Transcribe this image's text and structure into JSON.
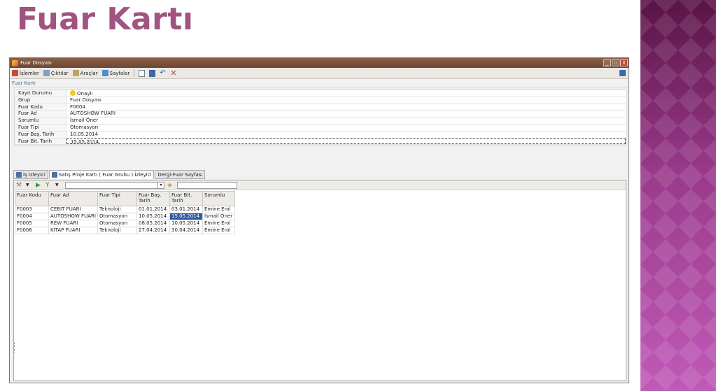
{
  "slide": {
    "title": "Fuar Kartı",
    "title_color": "#a0547f",
    "band_color": "#8a2c7c"
  },
  "window": {
    "title": "Fuar Dosyası",
    "controls": [
      "_",
      "▫",
      "X"
    ],
    "titlebar_color": "#6b4633"
  },
  "menubar": {
    "items": [
      {
        "label": "İşlemler",
        "icon": "operations-icon"
      },
      {
        "label": "Çıktılar",
        "icon": "outputs-icon"
      },
      {
        "label": "Araçlar",
        "icon": "tools-icon"
      },
      {
        "label": "Sayfalar",
        "icon": "pages-icon"
      }
    ],
    "tool_icons": [
      "new-document-icon",
      "save-icon",
      "undo-icon",
      "delete-icon"
    ]
  },
  "form": {
    "caption": "Fuar Kartı",
    "rows": [
      {
        "label": "Kayıt Durumu",
        "value": "Onaylı"
      },
      {
        "label": "Grup",
        "value": "Fuar Dosyası"
      },
      {
        "label": "Fuar Kodu",
        "value": "F0004"
      },
      {
        "label": "Fuar Ad",
        "value": "AUTOSHOW FUARI"
      },
      {
        "label": "Sorumlu",
        "value": "İsmail Öner"
      },
      {
        "label": "Fuar Tipi",
        "value": "Otomasyon"
      },
      {
        "label": "Fuar Baş. Tarih",
        "value": "10.05.2014"
      },
      {
        "label": "Fuar Bit. Tarih",
        "value": "15.05.2014"
      }
    ]
  },
  "tabs": [
    {
      "label": "İş İzleyici"
    },
    {
      "label": "Satış Proje Kartı ( Fuar Grubu ) İzleyici"
    },
    {
      "label": "Dergi-Fuar Sayfası"
    }
  ],
  "grid": {
    "columns": [
      "Fuar Kodu",
      "Fuar Ad",
      "Fuar Tipi",
      "Fuar Baş. Tarih",
      "Fuar Bit. Tarih",
      "Sorumlu"
    ],
    "rows": [
      [
        "F0003",
        "CEBIT FUARI",
        "Teknoloji",
        "01.01.2014",
        "03.01.2014",
        "Emine Erol"
      ],
      [
        "F0004",
        "AUTOSHOW FUARI",
        "Otomasyon",
        "10.05.2014",
        "15.05.2014",
        "İsmail Öner"
      ],
      [
        "F0005",
        "REW FUARI",
        "Otomasyon",
        "08.05.2014",
        "10.05.2014",
        "Emine Erol"
      ],
      [
        "F0006",
        "KİTAP FUARI",
        "Teknoloji",
        "27.04.2014",
        "30.04.2014",
        "Emine Erol"
      ]
    ],
    "selected_cell": {
      "row": 1,
      "col": 4
    },
    "selection_color": "#2f5aa0"
  }
}
